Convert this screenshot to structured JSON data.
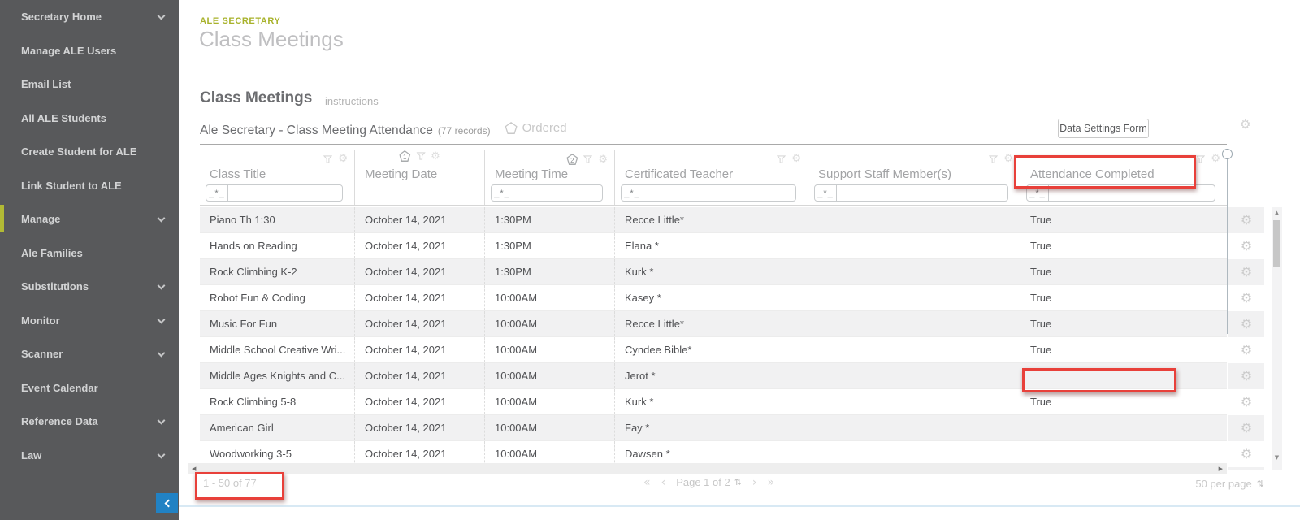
{
  "sidebar": {
    "items": [
      {
        "label": "Secretary Home",
        "expandable": true,
        "active": false
      },
      {
        "label": "Manage ALE Users",
        "expandable": false,
        "active": false
      },
      {
        "label": "Email List",
        "expandable": false,
        "active": false
      },
      {
        "label": "All ALE Students",
        "expandable": false,
        "active": false
      },
      {
        "label": "Create Student for ALE",
        "expandable": false,
        "active": false
      },
      {
        "label": "Link Student to ALE",
        "expandable": false,
        "active": false
      },
      {
        "label": "Manage",
        "expandable": true,
        "active": true
      },
      {
        "label": "Ale Families",
        "expandable": false,
        "active": false
      },
      {
        "label": "Substitutions",
        "expandable": true,
        "active": false
      },
      {
        "label": "Monitor",
        "expandable": true,
        "active": false
      },
      {
        "label": "Scanner",
        "expandable": true,
        "active": false
      },
      {
        "label": "Event Calendar",
        "expandable": false,
        "active": false
      },
      {
        "label": "Reference Data",
        "expandable": true,
        "active": false
      },
      {
        "label": "Law",
        "expandable": true,
        "active": false
      }
    ]
  },
  "header": {
    "eyebrow": "ALE SECRETARY",
    "title": "Class Meetings"
  },
  "section": {
    "title": "Class Meetings",
    "instructions_link": "instructions"
  },
  "toolbar": {
    "grid_title": "Ale Secretary - Class Meeting Attendance",
    "records_count": "(77 records)",
    "ordered_label": "Ordered",
    "data_settings_button": "Data Settings Form"
  },
  "table": {
    "filter_prefix": "_*_",
    "columns": [
      {
        "label": "Class Title",
        "sort_badge": ""
      },
      {
        "label": "Meeting Date",
        "sort_badge": "1"
      },
      {
        "label": "Meeting Time",
        "sort_badge": "2"
      },
      {
        "label": "Certificated Teacher",
        "sort_badge": ""
      },
      {
        "label": "Support Staff Member(s)",
        "sort_badge": ""
      },
      {
        "label": "Attendance Completed",
        "sort_badge": ""
      }
    ],
    "rows": [
      {
        "title": "Piano Th 1:30",
        "date": "October 14, 2021",
        "time": "1:30PM",
        "teacher": "Recce Little*",
        "support": "",
        "attendance": "True"
      },
      {
        "title": "Hands on Reading",
        "date": "October 14, 2021",
        "time": "1:30PM",
        "teacher": "Elana *",
        "support": "",
        "attendance": "True"
      },
      {
        "title": "Rock Climbing K-2",
        "date": "October 14, 2021",
        "time": "1:30PM",
        "teacher": "Kurk *",
        "support": "",
        "attendance": "True"
      },
      {
        "title": "Robot Fun & Coding",
        "date": "October 14, 2021",
        "time": "10:00AM",
        "teacher": "Kasey *",
        "support": "",
        "attendance": "True"
      },
      {
        "title": "Music For Fun",
        "date": "October 14, 2021",
        "time": "10:00AM",
        "teacher": "Recce Little*",
        "support": "",
        "attendance": "True"
      },
      {
        "title": "Middle School Creative Wri...",
        "date": "October 14, 2021",
        "time": "10:00AM",
        "teacher": "Cyndee Bible*",
        "support": "",
        "attendance": "True"
      },
      {
        "title": "Middle Ages Knights and C...",
        "date": "October 14, 2021",
        "time": "10:00AM",
        "teacher": "Jerot *",
        "support": "",
        "attendance": ""
      },
      {
        "title": "Rock Climbing 5-8",
        "date": "October 14, 2021",
        "time": "10:00AM",
        "teacher": "Kurk *",
        "support": "",
        "attendance": "True"
      },
      {
        "title": "American Girl",
        "date": "October 14, 2021",
        "time": "10:00AM",
        "teacher": "Fay *",
        "support": "",
        "attendance": ""
      },
      {
        "title": "Woodworking 3-5",
        "date": "October 14, 2021",
        "time": "10:00AM",
        "teacher": "Dawsen *",
        "support": "",
        "attendance": ""
      }
    ]
  },
  "pagination": {
    "range_label": "1 - 50 of 77",
    "first": "«",
    "prev": "‹",
    "page_label": "Page 1 of 2",
    "next": "›",
    "last": "»",
    "per_page_label": "50 per page"
  },
  "icons": {
    "gear": "⚙",
    "sorter": "⇅",
    "scroll_up": "▲",
    "scroll_down": "▼",
    "scroll_left": "◀",
    "scroll_right": "▶"
  },
  "colors": {
    "accent_green": "#b2ba35",
    "annotation_red": "#e8403a",
    "sidebar_bg": "#58595b",
    "collapse_blue": "#2182c4"
  }
}
